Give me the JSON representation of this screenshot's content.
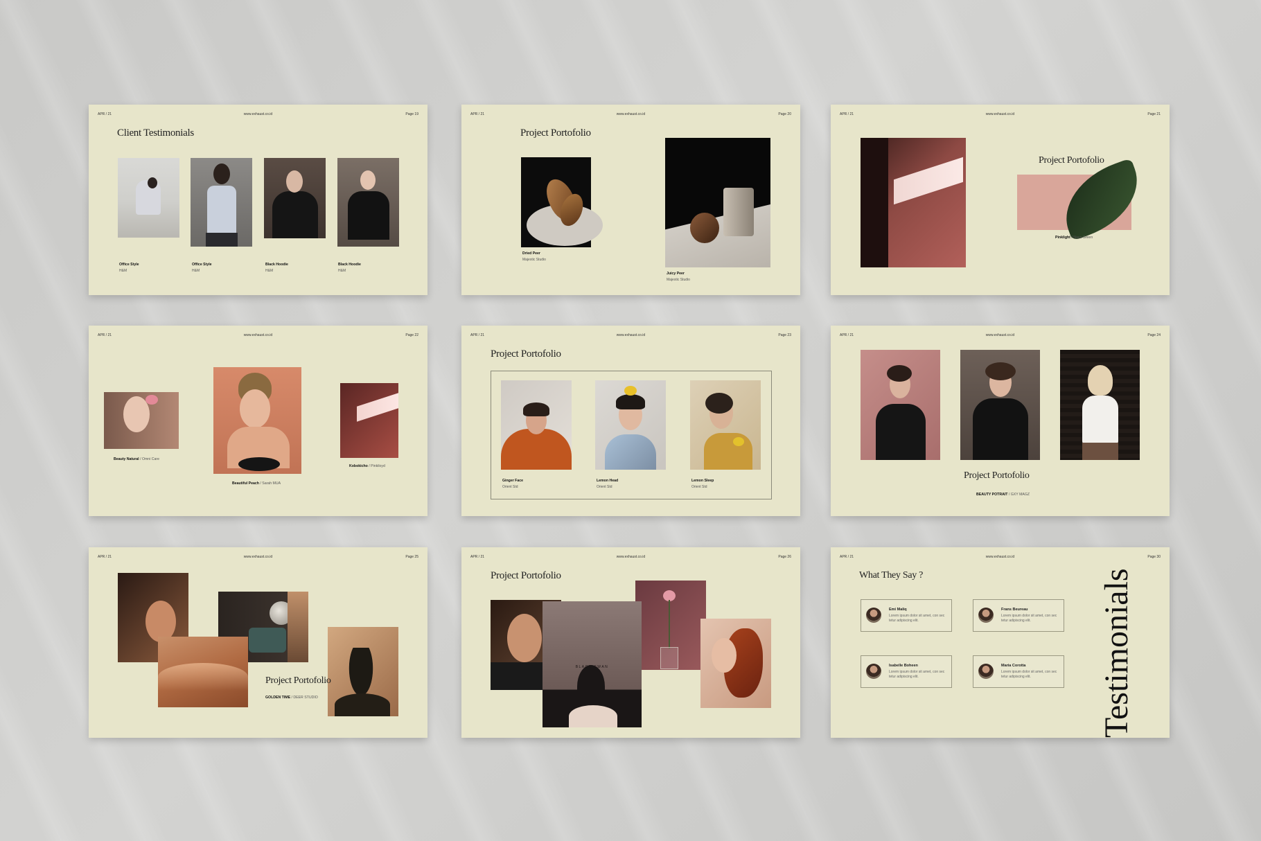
{
  "slides": [
    {
      "date": "APR / 21",
      "url": "www.exhaust.co.id",
      "page": "Page 19",
      "title": "Client Testimonials",
      "items": [
        {
          "name": "Office Style",
          "sub": "H&M"
        },
        {
          "name": "Office Style",
          "sub": "H&M"
        },
        {
          "name": "Black Hoodie",
          "sub": "H&M"
        },
        {
          "name": "Black Hoodie",
          "sub": "H&M"
        }
      ]
    },
    {
      "date": "APR / 21",
      "url": "www.exhaust.co.id",
      "page": "Page 20",
      "title": "Project Portofolio",
      "items": [
        {
          "name": "Dried Peer",
          "sub": "Majestic Studio"
        },
        {
          "name": "Juicy Peer",
          "sub": "Majestic Studio"
        }
      ]
    },
    {
      "date": "APR / 21",
      "url": "www.exhaust.co.id",
      "page": "Page 21",
      "title": "Project Portofolio",
      "caption_bold": "Pinklight",
      "caption_rest": " / Nava Green"
    },
    {
      "date": "APR / 21",
      "url": "www.exhaust.co.id",
      "page": "Page 22",
      "items": [
        {
          "bold": "Beauty Natural",
          "rest": " / Omni Care"
        },
        {
          "bold": "Beautiful Peach",
          "rest": " / Sarah MUA"
        },
        {
          "bold": "Kobokicho",
          "rest": " / Pinkiloyd"
        }
      ]
    },
    {
      "date": "APR / 21",
      "url": "www.exhaust.co.id",
      "page": "Page 23",
      "title": "Project Portofolio",
      "items": [
        {
          "name": "Ginger Face",
          "sub": "Orient Std"
        },
        {
          "name": "Lemon Head",
          "sub": "Orient Std"
        },
        {
          "name": "Lemon Sleep",
          "sub": "Orient Std"
        }
      ]
    },
    {
      "date": "APR / 21",
      "url": "www.exhaust.co.id",
      "page": "Page 24",
      "title": "Project Portofolio",
      "caption_bold": "BEAUTY POTRAIT",
      "caption_rest": " / GXY MAGZ"
    },
    {
      "date": "APR / 21",
      "url": "www.exhaust.co.id",
      "page": "Page 25",
      "title": "Project Portofolio",
      "caption_bold": "GOLDEN TIME",
      "caption_rest": " / DEER STUDIO"
    },
    {
      "date": "APR / 21",
      "url": "www.exhaust.co.id",
      "page": "Page 26",
      "title": "Project Portofolio",
      "overlay": "BLACK SWAN"
    },
    {
      "date": "APR / 21",
      "url": "www.exhaust.co.id",
      "page": "Page 30",
      "title": "What They Say ?",
      "side_title": "Testimonials",
      "testimonials": [
        {
          "name": "Emi Maliq",
          "text": "Lorem ipsum dolor sit amet, con sec tetur adipiscing elit."
        },
        {
          "name": "Frans Beureau",
          "text": "Lorem ipsum dolor sit amet, con sec tetur adipiscing elit."
        },
        {
          "name": "Isabelle Boheen",
          "text": "Lorem ipsum dolor sit amet, con sec tetur adipiscing elit."
        },
        {
          "name": "Maria Corotta",
          "text": "Lorem ipsum dolor sit amet, con sec tetur adipiscing elit."
        }
      ]
    }
  ]
}
